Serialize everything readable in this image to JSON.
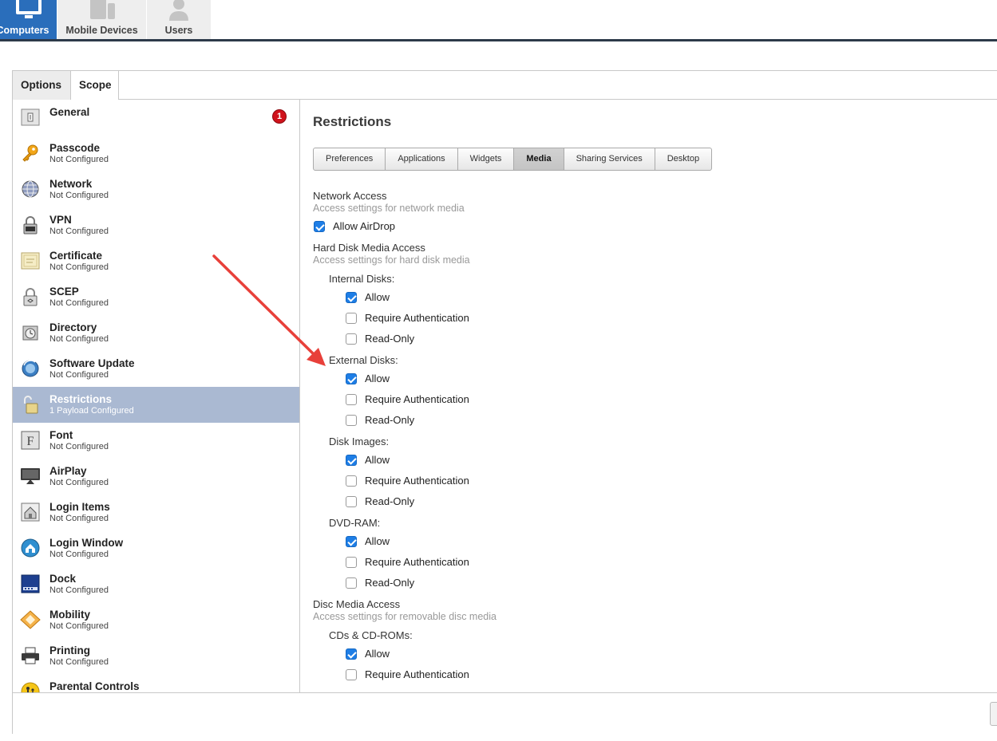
{
  "nav": {
    "tabs": [
      {
        "label": "Computers",
        "icon": "computer-icon",
        "active": true
      },
      {
        "label": "Mobile Devices",
        "icon": "mobile-devices-icon",
        "active": false
      },
      {
        "label": "Users",
        "icon": "user-icon",
        "active": false
      }
    ]
  },
  "subtabs": {
    "options": "Options",
    "scope": "Scope"
  },
  "sidebar": {
    "alert_badge": "1",
    "items": [
      {
        "name": "General",
        "status": "",
        "icon": "general-icon"
      },
      {
        "name": "Passcode",
        "status": "Not Configured",
        "icon": "key-icon"
      },
      {
        "name": "Network",
        "status": "Not Configured",
        "icon": "globe-icon"
      },
      {
        "name": "VPN",
        "status": "Not Configured",
        "icon": "lock-icon"
      },
      {
        "name": "Certificate",
        "status": "Not Configured",
        "icon": "certificate-icon"
      },
      {
        "name": "SCEP",
        "status": "Not Configured",
        "icon": "scep-lock-icon"
      },
      {
        "name": "Directory",
        "status": "Not Configured",
        "icon": "directory-icon"
      },
      {
        "name": "Software Update",
        "status": "Not Configured",
        "icon": "software-update-icon"
      },
      {
        "name": "Restrictions",
        "status": "1 Payload Configured",
        "icon": "padlock-icon",
        "active": true
      },
      {
        "name": "Font",
        "status": "Not Configured",
        "icon": "font-icon"
      },
      {
        "name": "AirPlay",
        "status": "Not Configured",
        "icon": "airplay-icon"
      },
      {
        "name": "Login Items",
        "status": "Not Configured",
        "icon": "login-items-icon"
      },
      {
        "name": "Login Window",
        "status": "Not Configured",
        "icon": "home-icon"
      },
      {
        "name": "Dock",
        "status": "Not Configured",
        "icon": "dock-icon"
      },
      {
        "name": "Mobility",
        "status": "Not Configured",
        "icon": "mobility-icon"
      },
      {
        "name": "Printing",
        "status": "Not Configured",
        "icon": "printer-icon"
      },
      {
        "name": "Parental Controls",
        "status": "",
        "icon": "parental-controls-icon"
      }
    ]
  },
  "content": {
    "title": "Restrictions",
    "tabs": [
      "Preferences",
      "Applications",
      "Widgets",
      "Media",
      "Sharing Services",
      "Desktop"
    ],
    "selected_tab": "Media",
    "network": {
      "title": "Network Access",
      "desc": "Access settings for network media",
      "airdrop": {
        "label": "Allow AirDrop",
        "checked": true
      }
    },
    "hard_disk": {
      "title": "Hard Disk Media Access",
      "desc": "Access settings for hard disk media",
      "groups": [
        {
          "label": "Internal Disks:",
          "options": [
            {
              "label": "Allow",
              "checked": true
            },
            {
              "label": "Require Authentication",
              "checked": false
            },
            {
              "label": "Read-Only",
              "checked": false
            }
          ]
        },
        {
          "label": "External Disks:",
          "options": [
            {
              "label": "Allow",
              "checked": true
            },
            {
              "label": "Require Authentication",
              "checked": false
            },
            {
              "label": "Read-Only",
              "checked": false
            }
          ]
        },
        {
          "label": "Disk Images:",
          "options": [
            {
              "label": "Allow",
              "checked": true
            },
            {
              "label": "Require Authentication",
              "checked": false
            },
            {
              "label": "Read-Only",
              "checked": false
            }
          ]
        },
        {
          "label": "DVD-RAM:",
          "options": [
            {
              "label": "Allow",
              "checked": true
            },
            {
              "label": "Require Authentication",
              "checked": false
            },
            {
              "label": "Read-Only",
              "checked": false
            }
          ]
        }
      ]
    },
    "disc": {
      "title": "Disc Media Access",
      "desc": "Access settings for removable disc media",
      "groups": [
        {
          "label": "CDs & CD-ROMs:",
          "options": [
            {
              "label": "Allow",
              "checked": true
            },
            {
              "label": "Require Authentication",
              "checked": false
            }
          ]
        }
      ]
    }
  },
  "colors": {
    "accent": "#2a6ebb",
    "selected_row": "#aab9d2",
    "checkbox_on": "#1e7ee6",
    "annotation_arrow": "#e8403a"
  }
}
